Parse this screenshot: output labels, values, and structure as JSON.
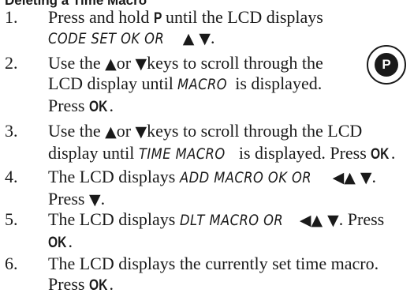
{
  "heading": "Deleting a Time Macro",
  "p_button": {
    "label": "P"
  },
  "steps": [
    {
      "num": "1.",
      "lines": [
        [
          "Press and hold ",
          {
            "key": "P"
          },
          " until the LCD displays"
        ],
        [
          {
            "lcd": "CODE SET OK OR"
          },
          " ",
          {
            "sym": "▲ ▼"
          },
          "."
        ]
      ]
    },
    {
      "num": "2.",
      "lines": [
        [
          "Use the  ",
          {
            "sym": "▲"
          },
          "or ",
          {
            "sym": "▼"
          },
          "keys to scroll through the"
        ],
        [
          "LCD display until ",
          {
            "lcd": "MACRO"
          },
          " is displayed."
        ],
        [
          "Press ",
          {
            "key": "OK"
          },
          "."
        ]
      ]
    },
    {
      "num": "3.",
      "lines": [
        [
          "Use the  ",
          {
            "sym": "▲"
          },
          "or ",
          {
            "sym": "▼"
          },
          "keys to scroll through the LCD"
        ],
        [
          "display until ",
          {
            "lcd": "TIME MACRO"
          },
          " is displayed. Press ",
          {
            "key": "OK"
          },
          "."
        ]
      ]
    },
    {
      "num": "4.",
      "lines": [
        [
          "The LCD displays ",
          {
            "lcd": "ADD MACRO OK OR"
          },
          " ",
          {
            "sym": "◀▲ ▼"
          },
          "."
        ],
        [
          "Press ",
          {
            "sym": "▼"
          },
          "."
        ]
      ]
    },
    {
      "num": "5.",
      "lines": [
        [
          "The LCD displays ",
          {
            "lcd": "DLT MACRO OR"
          },
          " ",
          {
            "sym": "◀▲ ▼"
          },
          ". Press"
        ],
        [
          {
            "key": "OK"
          },
          "."
        ]
      ]
    },
    {
      "num": "6.",
      "lines": [
        [
          "The LCD displays the currently set time macro."
        ],
        [
          "Press ",
          {
            "key": "OK"
          },
          "."
        ]
      ]
    }
  ]
}
